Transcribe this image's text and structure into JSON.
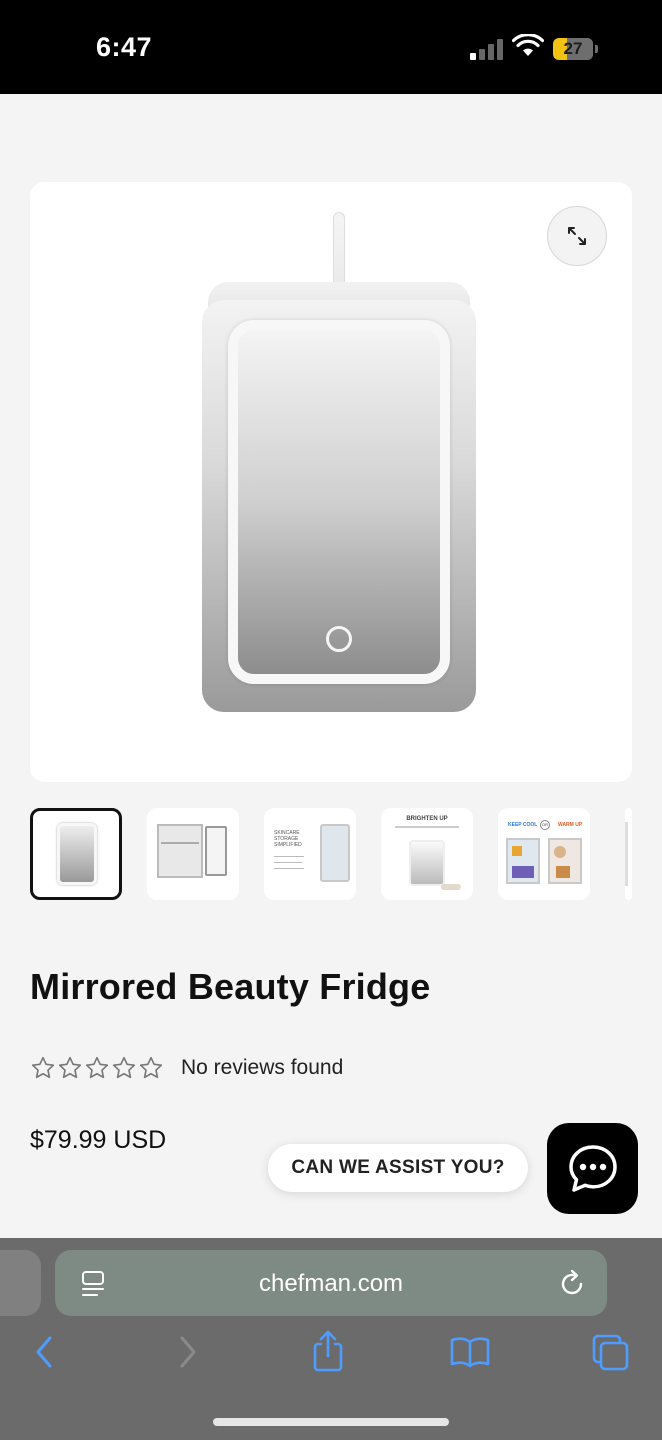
{
  "status_bar": {
    "time": "6:47",
    "battery": "27",
    "battery_color": "#f2c313"
  },
  "product": {
    "title": "Mirrored Beauty Fridge",
    "reviews_text": "No reviews found",
    "rating_stars": 0,
    "rating_max": 5,
    "price": "$79.99 USD",
    "image_icon": "fridge-image",
    "thumbnail_count": 6,
    "selected_thumbnail": 1
  },
  "thumbnails": [
    {
      "name": "front-view"
    },
    {
      "name": "open-interior"
    },
    {
      "name": "skincare-storage",
      "caption_1": "SKINCARE",
      "caption_2": "STORAGE",
      "caption_3": "SIMPLIFIED"
    },
    {
      "name": "brighten-up",
      "caption": "BRIGHTEN UP"
    },
    {
      "name": "keep-cool-warm-up",
      "caption_left": "KEEP COOL",
      "caption_or": "OR",
      "caption_right": "WARM UP"
    }
  ],
  "assist": {
    "label": "CAN WE ASSIST YOU?"
  },
  "browser": {
    "url": "chefman.com"
  },
  "icons": {
    "expand": "expand-icon",
    "chat": "chat-bubble-icon",
    "back": "back-chevron-icon",
    "forward": "forward-chevron-icon",
    "share": "share-icon",
    "bookmarks": "book-icon",
    "tabs": "tabs-icon"
  }
}
